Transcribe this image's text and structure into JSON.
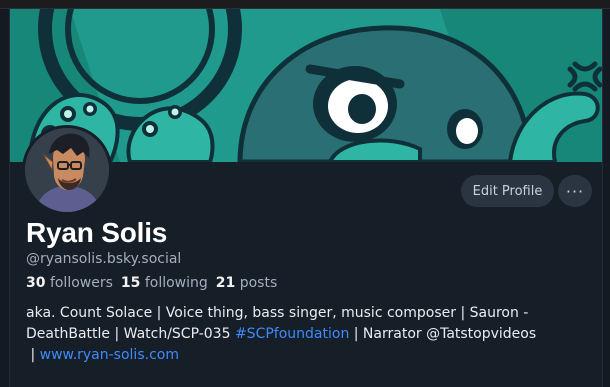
{
  "profile": {
    "display_name": "Ryan Solis",
    "handle": "@ryansolis.bsky.social",
    "followers_count": "30",
    "followers_label": "followers",
    "following_count": "15",
    "following_label": "following",
    "posts_count": "21",
    "posts_label": "posts"
  },
  "actions": {
    "edit_profile_label": "Edit Profile",
    "more_label": "···"
  },
  "bio": {
    "line1_text": "aka. Count Solace | Voice thing, bass singer, music composer | Sauron -",
    "line2_pre": "DeathBattle | Watch/SCP-035 ",
    "hashtag": "#SCPfoundation",
    "line2_post": " | Narrator @Tatstopvideos",
    "line3_pre": " | ",
    "website": "www.ryan-solis.com"
  },
  "icons": {
    "more": "ellipsis-icon"
  },
  "colors": {
    "background": "#161e27",
    "banner_teal": "#1f9a8c",
    "link": "#3d8bfd",
    "button_bg": "#2b3541"
  }
}
